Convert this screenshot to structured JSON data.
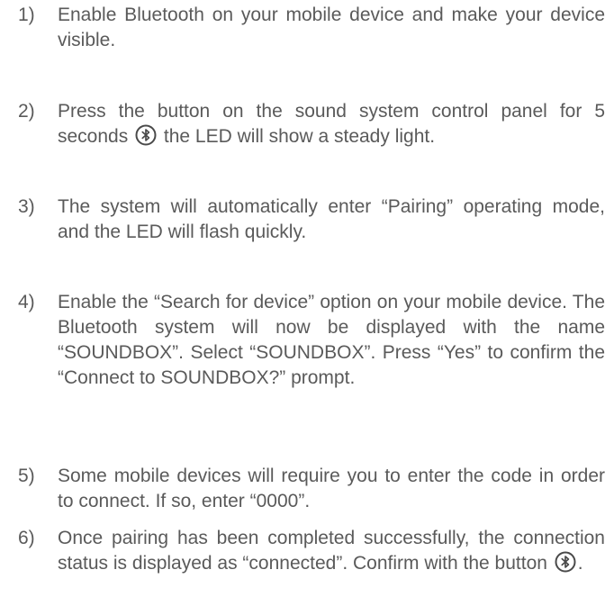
{
  "steps": [
    {
      "number": "1)",
      "text": "Enable Bluetooth on your mobile device and make your device visible."
    },
    {
      "number": "2)",
      "text_before": "Press the button on the sound system control panel for 5 seconds",
      "icon": "bluetooth-icon",
      "text_after": "the LED will show a steady light."
    },
    {
      "number": "3)",
      "text": "The system will automatically enter “Pairing” operating mode, and the LED will flash quickly."
    },
    {
      "number": "4)",
      "text": "Enable the “Search for device” option on your mobile device. The Bluetooth system will now be displayed with the name “SOUNDBOX”. Select “SOUNDBOX”. Press “Yes” to confirm the “Connect to SOUNDBOX?” prompt."
    },
    {
      "number": "5)",
      "text": "Some mobile devices will require you to enter the code in order to connect. If so, enter “0000”."
    },
    {
      "number": "6)",
      "text_before": "Once pairing has been completed successfully, the connection status is displayed as “connected”. Confirm with the button",
      "icon": "bluetooth-icon",
      "text_after": "."
    }
  ],
  "colors": {
    "text": "#5a5a5a",
    "icon_stroke": "#4a4a4a",
    "background": "#ffffff"
  }
}
